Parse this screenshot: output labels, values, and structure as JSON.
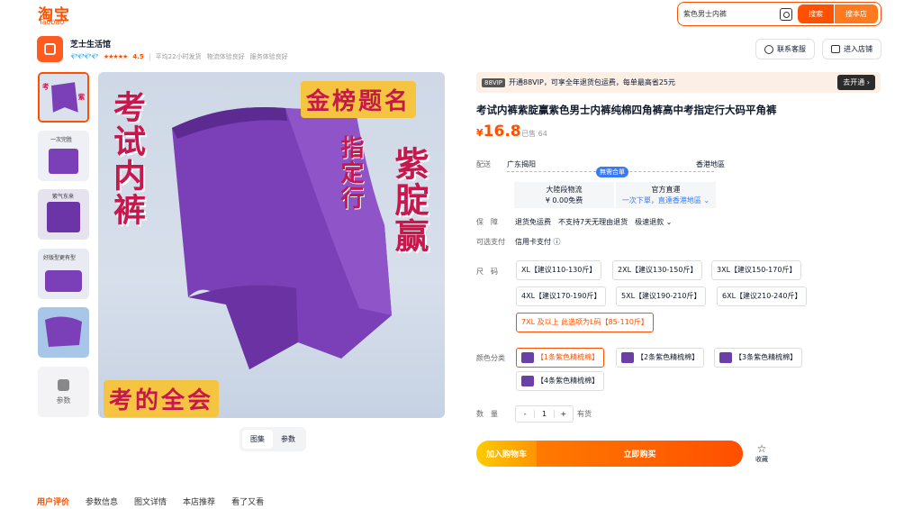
{
  "header": {
    "logo_cn": "淘宝",
    "logo_en": "Taobao",
    "search_query": "紫色男士内裤",
    "search_label": "搜索",
    "search_store_label": "搜本店"
  },
  "shop": {
    "name": "芝士生活馆",
    "diamonds": "💎💎💎💎",
    "stars": "★★★★★",
    "score": "4.5",
    "meta": [
      "平均22小时发货",
      "物流体验良好",
      "服务体验良好"
    ],
    "contact_label": "联系客服",
    "enter_label": "进入店铺"
  },
  "gallery": {
    "params_label": "参数",
    "main_texts": {
      "left": "考试内裤",
      "middle": "指定行",
      "right": "紫腚赢",
      "top_banner": "金榜题名",
      "bottom_banner": "考的全会"
    },
    "tabs": [
      "图集",
      "参数"
    ],
    "thumb_captions": [
      "",
      "一次完胜",
      "紫气东来",
      "好版型更有型",
      ""
    ],
    "accent_color": "#ff5000",
    "product_color": "#7b3fb8"
  },
  "product": {
    "vip_tag": "88VIP",
    "vip_text": "开通88VIP，可享全年退货包运费，每单最高省25元",
    "vip_go": "去开通 ›",
    "title": "考试内裤紫腚赢紫色男士内裤纯棉四角裤高中考指定行大码平角裤",
    "price_symbol": "¥",
    "price": "16.8",
    "sold": "· 已售 64",
    "delivery": {
      "label": "配送",
      "from": "广东揭阳",
      "to": "香港地區",
      "tag": "無需合單",
      "box1_title": "大陸段物流",
      "box1_value": "¥ 0.00免费",
      "box2_title": "官方直運",
      "box2_value": "一次下單，直達香港地區 ⌄"
    },
    "guarantee": {
      "label": "保　障",
      "items": [
        "退货免运费",
        "不支持7天无理由退货",
        "极速退款 ⌄"
      ]
    },
    "payment": {
      "label": "可选支付",
      "value": "信用卡支付 ⓘ"
    },
    "size": {
      "label": "尺　码",
      "options": [
        "XL【建议110-130斤】",
        "2XL【建议130-150斤】",
        "3XL【建议150-170斤】",
        "4XL【建议170-190斤】",
        "5XL【建议190-210斤】",
        "6XL【建议210-240斤】",
        "7XL 及以上 此选项为L码【85-110斤】"
      ]
    },
    "color": {
      "label": "颜色分类",
      "options": [
        "【1条紫色精梳棉】",
        "【2条紫色精梳棉】",
        "【3条紫色精梳棉】",
        "【4条紫色精梳棉】"
      ]
    },
    "quantity": {
      "label": "数　量",
      "minus": "-",
      "value": "1",
      "plus": "+",
      "stock": "有货"
    },
    "cart_label": "加入购物车",
    "buy_label": "立即购买",
    "fav_label": "收藏"
  },
  "bottom_tabs": [
    "用户评价",
    "参数信息",
    "图文详情",
    "本店推荐",
    "看了又看"
  ]
}
